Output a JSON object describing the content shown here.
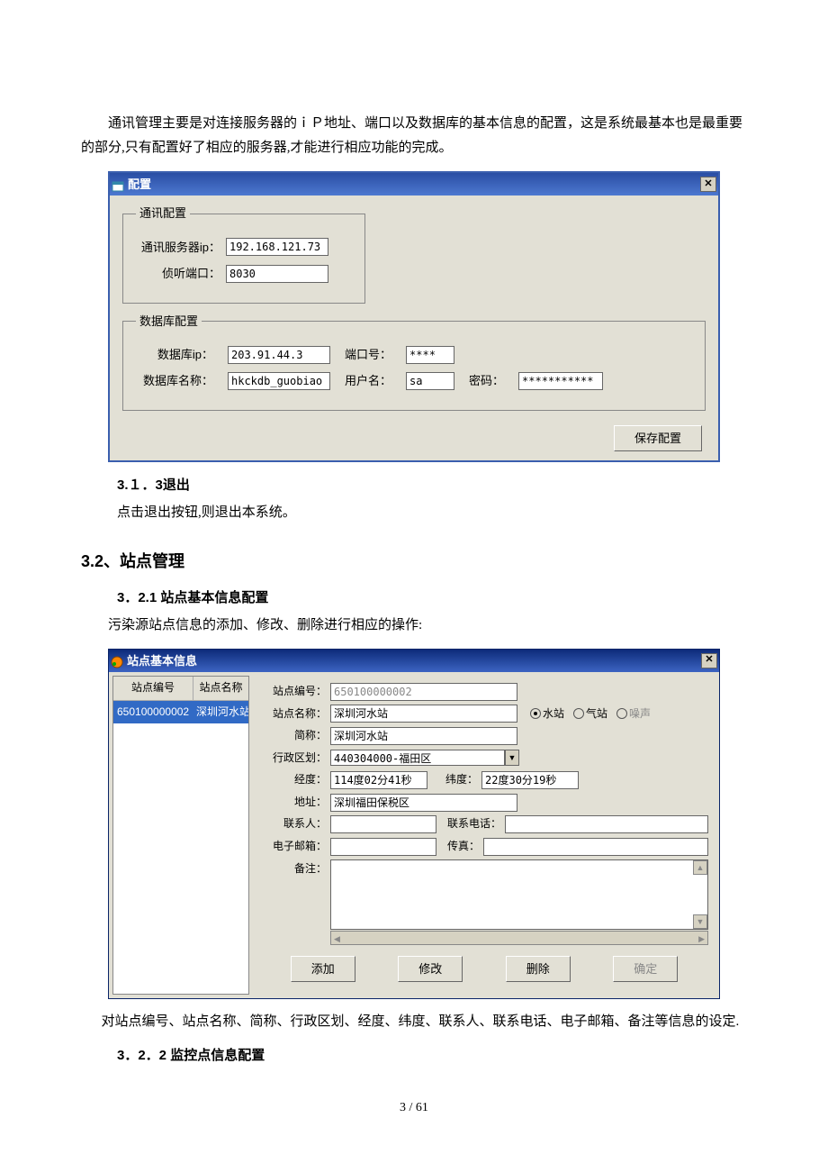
{
  "intro": "通讯管理主要是对连接服务器的ｉＰ地址、端口以及数据库的基本信息的配置，这是系统最基本也是最重要的部分,只有配置好了相应的服务器,才能进行相应功能的完成。",
  "config_dialog": {
    "title": "配置",
    "comm_legend": "通讯配置",
    "comm_server_label": "通讯服务器ip：",
    "comm_server_value": "192.168.121.73",
    "listen_port_label": "侦听端口：",
    "listen_port_value": "8030",
    "db_legend": "数据库配置",
    "db_ip_label": "数据库ip：",
    "db_ip_value": "203.91.44.3",
    "db_port_label": "端口号：",
    "db_port_value": "****",
    "db_name_label": "数据库名称：",
    "db_name_value": "hkckdb_guobiao",
    "db_user_label": "用户名：",
    "db_user_value": "sa",
    "db_pwd_label": "密码：",
    "db_pwd_value": "***********",
    "save_button": "保存配置"
  },
  "sec313": {
    "heading": "3.１．3退出",
    "body": "点击退出按钮,则退出本系统。"
  },
  "sec32": {
    "heading": "3.2、站点管理",
    "sub321_heading": "3．2.1 站点基本信息配置",
    "sub321_body": "污染源站点信息的添加、修改、删除进行相应的操作:"
  },
  "station_dialog": {
    "title": "站点基本信息",
    "list_headers": {
      "col1": "站点编号",
      "col2": "站点名称"
    },
    "list_row": {
      "col1": "650100000002",
      "col2": "深圳河水站"
    },
    "labels": {
      "site_no": "站点编号：",
      "site_name": "站点名称：",
      "short_name": "简称：",
      "district": "行政区划：",
      "lon": "经度：",
      "lat": "纬度：",
      "address": "地址：",
      "contact": "联系人：",
      "phone": "联系电话：",
      "email": "电子邮箱：",
      "fax": "传真：",
      "remark": "备注："
    },
    "values": {
      "site_no": "650100000002",
      "site_name": "深圳河水站",
      "short_name": "深圳河水站",
      "district": "440304000-福田区",
      "lon": "114度02分41秒",
      "lat": "22度30分19秒",
      "address": "深圳福田保税区",
      "contact": "",
      "phone": "",
      "email": "",
      "fax": "",
      "remark": ""
    },
    "radio": {
      "water": "水站",
      "air": "气站",
      "noise": "噪声"
    },
    "buttons": {
      "add": "添加",
      "edit": "修改",
      "del": "删除",
      "ok": "确定"
    }
  },
  "post_station": "      对站点编号、站点名称、简称、行政区划、经度、纬度、联系人、联系电话、电子邮箱、备注等信息的设定.",
  "sec322_heading": "3．2．2 监控点信息配置",
  "page_num": "3 / 61"
}
